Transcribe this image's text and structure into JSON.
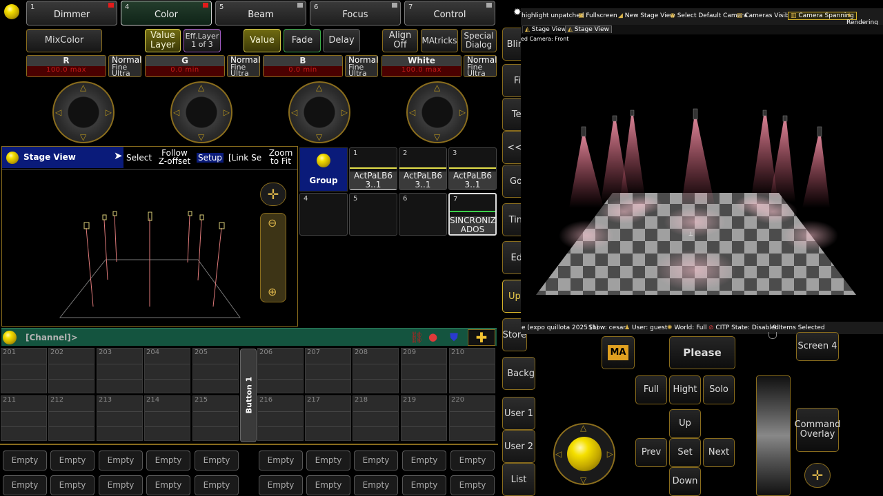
{
  "func_tabs": [
    {
      "num": "1",
      "label": "Dimmer",
      "state": "red"
    },
    {
      "num": "4",
      "label": "Color",
      "state": "red"
    },
    {
      "num": "5",
      "label": "Beam",
      "state": "gray"
    },
    {
      "num": "6",
      "label": "Focus",
      "state": "gray"
    },
    {
      "num": "7",
      "label": "Control",
      "state": "gray"
    }
  ],
  "color_bar": {
    "mixcolor": "MixColor",
    "value_layer": "Value Layer",
    "eff_layer": "Eff.Layer",
    "eff_layer_sub": "1 of 3",
    "value": "Value",
    "fade": "Fade",
    "delay": "Delay",
    "align_off": "Align Off",
    "matricks": "MAtricks",
    "special_dialog": "Special Dialog"
  },
  "attributes": [
    {
      "name": "R",
      "value": "100.0 max",
      "mode": [
        "Normal",
        "Fine",
        "Ultra"
      ]
    },
    {
      "name": "G",
      "value": "0.0 min",
      "mode": [
        "Normal",
        "Fine",
        "Ultra"
      ]
    },
    {
      "name": "B",
      "value": "0.0 min",
      "mode": [
        "Normal",
        "Fine",
        "Ultra"
      ]
    },
    {
      "name": "White",
      "value": "100.0 max",
      "mode": [
        "Normal",
        "Fine",
        "Ultra"
      ]
    }
  ],
  "stage_view": {
    "title": "Stage View",
    "select": "Select",
    "follow": "Follow Z-offset",
    "setup": "Setup",
    "link": "[Link Se",
    "zoom_fit": "Zoom to Fit"
  },
  "group_pool": {
    "title": "Group",
    "items": [
      {
        "num": "1",
        "label": "ActPaLB6 3..1"
      },
      {
        "num": "2",
        "label": "ActPaLB6 3..1"
      },
      {
        "num": "3",
        "label": "ActPaLB6 3..1"
      },
      {
        "num": "4",
        "label": ""
      },
      {
        "num": "5",
        "label": ""
      },
      {
        "num": "6",
        "label": ""
      },
      {
        "num": "7",
        "label": "SINCRONIZ ADOS"
      }
    ]
  },
  "cmdline": {
    "text": "[Channel]>"
  },
  "fader_row1": [
    "201",
    "202",
    "203",
    "204",
    "205",
    "206",
    "207",
    "208",
    "209",
    "210"
  ],
  "fader_row2": [
    "211",
    "212",
    "213",
    "214",
    "215",
    "216",
    "217",
    "218",
    "219",
    "220"
  ],
  "button1": "Button 1",
  "exec_label": "Empty",
  "side_buttons": [
    "Blin",
    "Fi",
    "Ter",
    "<<",
    "Go",
    "Tin",
    "Ed",
    "Upd",
    "Store",
    "Backg",
    "User 1",
    "User 2",
    "List"
  ],
  "viz": {
    "toolbar": [
      "highlight unpatched",
      "Fullscreen",
      "New Stage View",
      "Select Default Camera",
      "Cameras Visible",
      "Camera Spanning",
      "Rendering"
    ],
    "tabs": [
      "Stage View",
      "Stage View"
    ],
    "camera": "ed Camera: Front",
    "status": [
      "e (expo quillota 2025 (1)",
      "Show: cesar",
      "User: guest",
      "World: Full",
      "CITP State: Disabled",
      "9 Items Selected"
    ]
  },
  "right": {
    "please": "Please",
    "full": "Full",
    "hight": "Hight",
    "solo": "Solo",
    "up": "Up",
    "prev": "Prev",
    "set": "Set",
    "next": "Next",
    "down": "Down",
    "screen4": "Screen 4",
    "cmd_overlay": "Command Overlay",
    "logo": "MA"
  },
  "colors": {
    "accent": "#8a6d1d",
    "yellow": "#f5e000",
    "selected": "#d6c94a",
    "stage_blue": "#0a1b7a",
    "cmd_green": "#14543f"
  }
}
